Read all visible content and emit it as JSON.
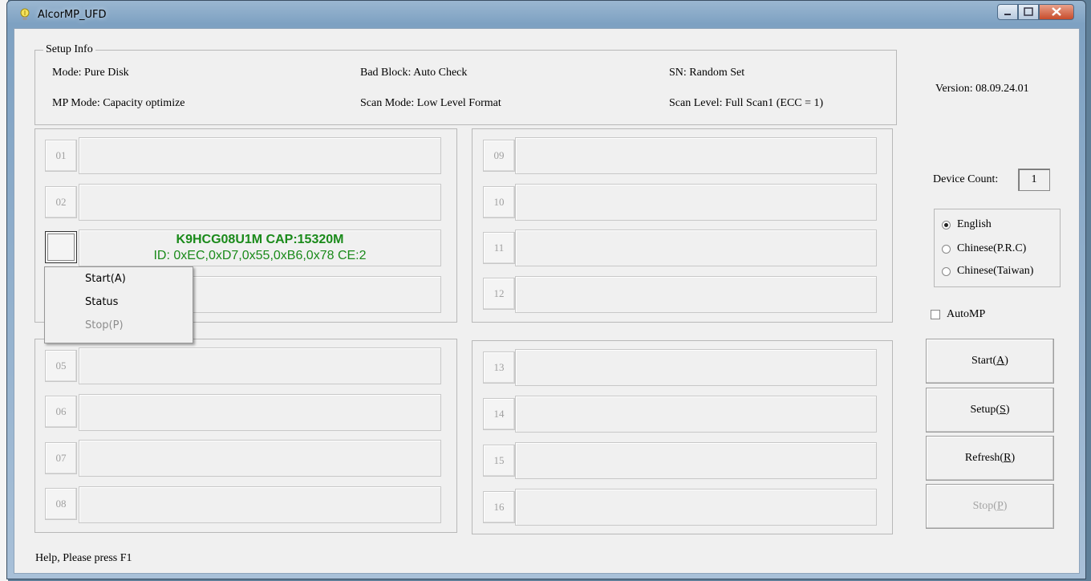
{
  "window": {
    "title": "AlcorMP_UFD"
  },
  "setup_info": {
    "legend": "Setup Info",
    "mode": "Mode: Pure Disk",
    "bad_block": "Bad Block: Auto Check",
    "sn": "SN: Random Set",
    "mp_mode": "MP Mode: Capacity optimize",
    "scan_mode": "Scan Mode: Low Level Format",
    "scan_level": "Scan Level: Full Scan1 (ECC = 1)"
  },
  "version": "Version: 08.09.24.01",
  "slots": {
    "s01": "01",
    "s02": "02",
    "s05": "05",
    "s06": "06",
    "s07": "07",
    "s08": "08",
    "s09": "09",
    "s10": "10",
    "s11": "11",
    "s12": "12",
    "s13": "13",
    "s14": "14",
    "s15": "15",
    "s16": "16"
  },
  "active_slot": {
    "line1": "K9HCG08U1M CAP:15320M",
    "line2": "ID: 0xEC,0xD7,0x55,0xB6,0x78  CE:2"
  },
  "context_menu": {
    "start": "Start(A)",
    "status": "Status",
    "stop": "Stop(P)"
  },
  "device_count": {
    "label": "Device Count:",
    "value": "1"
  },
  "language": {
    "english": "English",
    "chinese_prc": "Chinese(P.R.C)",
    "chinese_taiwan": "Chinese(Taiwan)",
    "selected": "English"
  },
  "automp": {
    "label": "AutoMP",
    "checked": false
  },
  "buttons": {
    "start_pre": "Start(",
    "start_key": "A",
    "start_post": ")",
    "setup_pre": "Setup(",
    "setup_key": "S",
    "setup_post": ")",
    "refresh_pre": "Refresh(",
    "refresh_key": "R",
    "refresh_post": ")",
    "stop_pre": "Stop(",
    "stop_key": "P",
    "stop_post": ")"
  },
  "status_bar": "Help, Please press F1",
  "colors": {
    "active_text": "#1a8a1a",
    "disabled_text": "#a3a3a3"
  }
}
